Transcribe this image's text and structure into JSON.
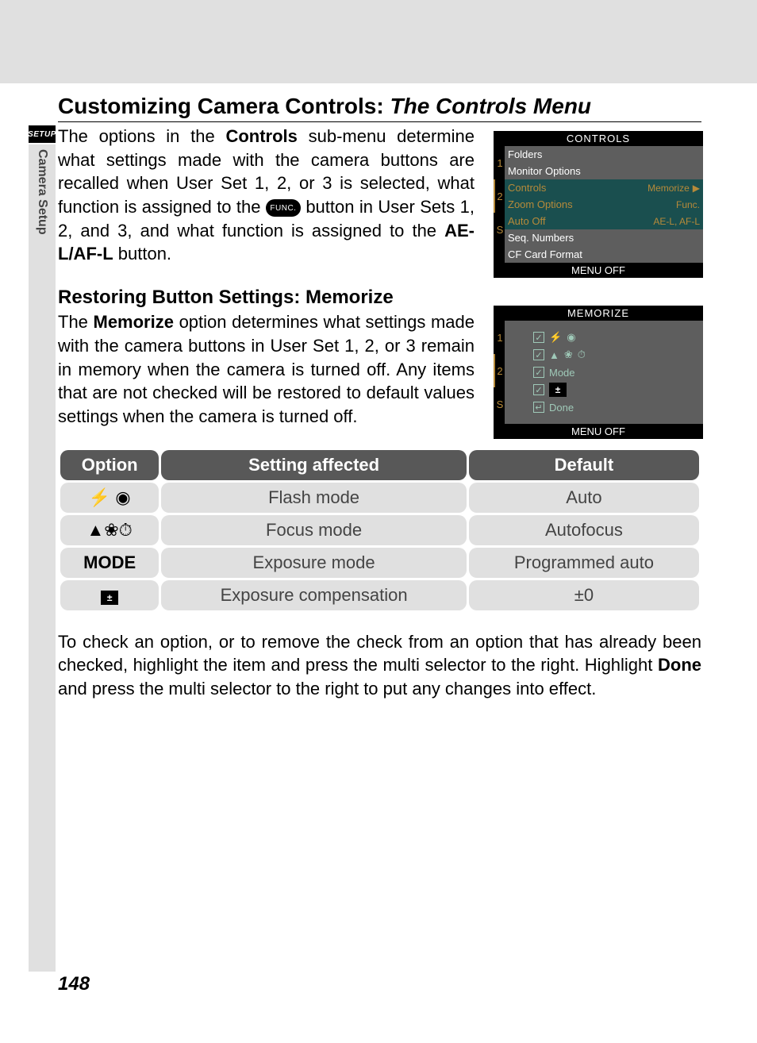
{
  "sidebar": {
    "badge": "SETUP",
    "vertical_label": "Camera Setup"
  },
  "heading": {
    "prefix": "Customizing Camera Controls: ",
    "italic": "The Controls Menu"
  },
  "para1_a": "The options in the ",
  "para1_b": "Controls",
  "para1_c": " sub-menu determine what settings made with the camera buttons are recalled when User Set 1, 2, or 3 is selected, what function is assigned to the ",
  "para1_func": "FUNC.",
  "para1_d": " button in User Sets 1, 2, and 3, and what function is assigned to the ",
  "para1_e": "AE-L/AF-L",
  "para1_f": " button.",
  "h2": "Restoring Button Settings: Memorize",
  "para2_a": "The ",
  "para2_b": "Memorize",
  "para2_c": " option determines what settings made with the camera buttons in User Set 1, 2, or 3 remain in memory when the camera is turned off. Any items that are not checked will be restored to default values settings when the camera is turned off.",
  "lcd1": {
    "title": "CONTROLS",
    "tabs": [
      "1",
      "2",
      "S"
    ],
    "rows": [
      {
        "label": "Folders",
        "value": "",
        "cls": "dark"
      },
      {
        "label": "Monitor Options",
        "value": "",
        "cls": "dark"
      },
      {
        "label": "Controls",
        "value": "Memorize",
        "cls": "teal",
        "arrow": true
      },
      {
        "label": "Zoom Options",
        "value": "Func.",
        "cls": "teal"
      },
      {
        "label": "Auto Off",
        "value": "AE-L, AF-L",
        "cls": "teal"
      },
      {
        "label": "Seq. Numbers",
        "value": "",
        "cls": "dark"
      },
      {
        "label": "CF Card Format",
        "value": "",
        "cls": "dark"
      }
    ],
    "footer": "MENU OFF"
  },
  "lcd2": {
    "title": "MEMORIZE",
    "tabs": [
      "1",
      "2",
      "S"
    ],
    "options": [
      {
        "checked": true,
        "icons": "flash-eye"
      },
      {
        "checked": true,
        "icons": "mountain-flower-timer"
      },
      {
        "checked": true,
        "label": "Mode"
      },
      {
        "checked": true,
        "icons": "expcomp"
      },
      {
        "checked": false,
        "label": "Done",
        "enter": true
      }
    ],
    "footer": "MENU OFF"
  },
  "table": {
    "headers": [
      "Option",
      "Setting affected",
      "Default"
    ],
    "rows": [
      {
        "opt_icons": "flash-eye",
        "opt_text": "",
        "setting": "Flash mode",
        "def": "Auto"
      },
      {
        "opt_icons": "mountain-flower-timer",
        "opt_text": "",
        "setting": "Focus mode",
        "def": "Autofocus"
      },
      {
        "opt_icons": "",
        "opt_text": "MODE",
        "setting": "Exposure mode",
        "def": "Programmed auto"
      },
      {
        "opt_icons": "expcomp",
        "opt_text": "",
        "setting": "Exposure compensation",
        "def": "±0"
      }
    ]
  },
  "para3_a": "To check an option, or to remove the check from an option that has already been checked, highlight the item and press the multi selector to the right. Highlight ",
  "para3_b": "Done",
  "para3_c": " and press the multi selector to the right to put any changes into effect.",
  "page_num": "148"
}
